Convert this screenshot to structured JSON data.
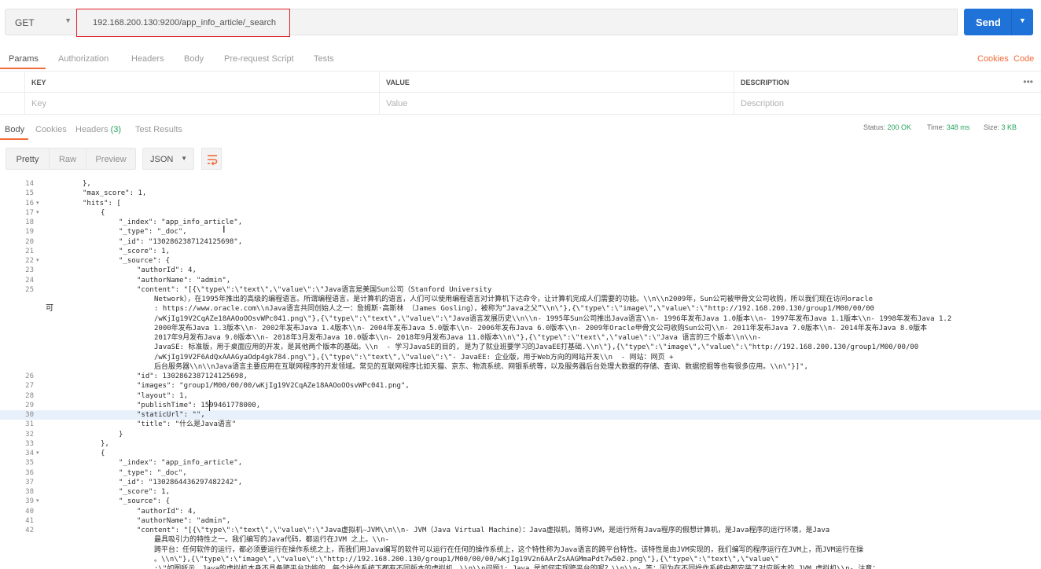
{
  "request": {
    "method": "GET",
    "url": "192.168.200.130:9200/app_info_article/_search",
    "send_label": "Send"
  },
  "request_tabs": [
    "Params",
    "Authorization",
    "Headers",
    "Body",
    "Pre-request Script",
    "Tests"
  ],
  "request_right_links": [
    "Cookies",
    "Code"
  ],
  "params_table": {
    "headers": [
      "KEY",
      "VALUE",
      "DESCRIPTION"
    ],
    "placeholders": [
      "Key",
      "Value",
      "Description"
    ],
    "menu": "•••"
  },
  "response_tabs": {
    "body": "Body",
    "cookies": "Cookies",
    "headers": "Headers",
    "headers_count": "(3)",
    "tests": "Test Results"
  },
  "status": {
    "status_label": "Status:",
    "status_value": "200 OK",
    "time_label": "Time:",
    "time_value": "348 ms",
    "size_label": "Size:",
    "size_value": "3 KB"
  },
  "toolbar": {
    "pretty": "Pretty",
    "raw": "Raw",
    "preview": "Preview",
    "format": "JSON"
  },
  "gutter_stray": "可",
  "code_lines": [
    {
      "n": "14",
      "fold": "",
      "indent": 0,
      "text": "},"
    },
    {
      "n": "15",
      "fold": "",
      "indent": 0,
      "text": "\"max_score\": 1,"
    },
    {
      "n": "16",
      "fold": "▾",
      "indent": 0,
      "text": "\"hits\": ["
    },
    {
      "n": "17",
      "fold": "▾",
      "indent": 1,
      "text": "{"
    },
    {
      "n": "18",
      "fold": "",
      "indent": 2,
      "text": "\"_index\": \"app_info_article\","
    },
    {
      "n": "19",
      "fold": "",
      "indent": 2,
      "text": "\"_type\": \"_doc\","
    },
    {
      "n": "20",
      "fold": "",
      "indent": 2,
      "text": "\"_id\": \"1302862387124125698\","
    },
    {
      "n": "21",
      "fold": "",
      "indent": 2,
      "text": "\"_score\": 1,"
    },
    {
      "n": "22",
      "fold": "▾",
      "indent": 2,
      "text": "\"_source\": {"
    },
    {
      "n": "23",
      "fold": "",
      "indent": 3,
      "text": "\"authorId\": 4,"
    },
    {
      "n": "24",
      "fold": "",
      "indent": 3,
      "text": "\"authorName\": \"admin\","
    },
    {
      "n": "25",
      "fold": "",
      "indent": 3,
      "text": "\"content\": \"[{\\\"type\\\":\\\"text\\\",\\\"value\\\":\\\"Java语言是美国Sun公司（Stanford University"
    },
    {
      "n": "",
      "fold": "",
      "indent": 4,
      "text": "Network），在1995年推出的高级的编程语言。所谓编程语言，是计算机的语言，人们可以使用编程语言对计算机下达命令，让计算机完成人们需要的功能。\\\\n\\\\n2009年，Sun公司被甲骨文公司收购，所以我们现在访问oracle"
    },
    {
      "n": "",
      "fold": "",
      "indent": 4,
      "text": ": https://www.oracle.com\\\\nJava语言共同创始人之一：詹姆斯·高斯林 （James Gosling），被称为“Java之父”\\\\n\\\"},{\\\"type\\\":\\\"image\\\",\\\"value\\\":\\\"http://192.168.200.130/group1/M00/00/00"
    },
    {
      "n": "",
      "fold": "",
      "indent": 4,
      "text": "/wKjIg19V2CqAZe18AAOoOOsvWPc041.png\\\"},{\\\"type\\\":\\\"text\\\",\\\"value\\\":\\\"Java语言发展历史\\\\n\\\\n- 1995年Sun公司推出Java语言\\\\n- 1996年发布Java 1.0版本\\\\n- 1997年发布Java 1.1版本\\\\n- 1998年发布Java 1.2"
    },
    {
      "n": "",
      "fold": "",
      "indent": 4,
      "text": "2000年发布Java 1.3版本\\\\n- 2002年发布Java 1.4版本\\\\n- 2004年发布Java 5.0版本\\\\n- 2006年发布Java 6.0版本\\\\n- 2009年Oracle甲骨文公司收购Sun公司\\\\n- 2011年发布Java 7.0版本\\\\n- 2014年发布Java 8.0版本"
    },
    {
      "n": "",
      "fold": "",
      "indent": 4,
      "text": "2017年9月发布Java 9.0版本\\\\n- 2018年3月发布Java 10.0版本\\\\n- 2018年9月发布Java 11.0版本\\\\n\\\"},{\\\"type\\\":\\\"text\\\",\\\"value\\\":\\\"Java 语言的三个版本\\\\n\\\\n-"
    },
    {
      "n": "",
      "fold": "",
      "indent": 4,
      "text": "JavaSE: 标准版，用于桌面应用的开发，是其他两个版本的基础。\\\\n  - 学习JavaSE的目的, 是为了就业班要学习的JavaEE打基础.\\\\n\\\"},{\\\"type\\\":\\\"image\\\",\\\"value\\\":\\\"http://192.168.200.130/group1/M00/00/00"
    },
    {
      "n": "",
      "fold": "",
      "indent": 4,
      "text": "/wKjIg19V2F6AdQxAAAGyaOdp4gk784.png\\\"},{\\\"type\\\":\\\"text\\\",\\\"value\\\":\\\"- JavaEE: 企业版，用于Web方向的网站开发\\\\n  - 网站：网页 +"
    },
    {
      "n": "",
      "fold": "",
      "indent": 4,
      "text": "后台服务器\\\\n\\\\nJava语言主要应用在互联网程序的开发领域。常见的互联网程序比如天猫、京东、物流系统、网银系统等，以及服务器后台处理大数据的存储、查询、数据挖掘等也有很多应用。\\\\n\\\"}]\","
    },
    {
      "n": "26",
      "fold": "",
      "indent": 3,
      "text": "\"id\": 1302862387124125698,"
    },
    {
      "n": "27",
      "fold": "",
      "indent": 3,
      "text": "\"images\": \"group1/M00/00/00/wKjIg19V2CqAZe18AAOoOOsvWPc041.png\","
    },
    {
      "n": "28",
      "fold": "",
      "indent": 3,
      "text": "\"layout\": 1,"
    },
    {
      "n": "29",
      "fold": "",
      "indent": 3,
      "text": "\"publishTime\": 1599461778000,"
    },
    {
      "n": "30",
      "fold": "",
      "indent": 3,
      "text": "\"staticUrl\": \"\","
    },
    {
      "n": "31",
      "fold": "",
      "indent": 3,
      "text": "\"title\": \"什么是Java语言\""
    },
    {
      "n": "32",
      "fold": "",
      "indent": 2,
      "text": "}"
    },
    {
      "n": "33",
      "fold": "",
      "indent": 1,
      "text": "},"
    },
    {
      "n": "34",
      "fold": "▾",
      "indent": 1,
      "text": "{"
    },
    {
      "n": "35",
      "fold": "",
      "indent": 2,
      "text": "\"_index\": \"app_info_article\","
    },
    {
      "n": "36",
      "fold": "",
      "indent": 2,
      "text": "\"_type\": \"_doc\","
    },
    {
      "n": "37",
      "fold": "",
      "indent": 2,
      "text": "\"_id\": \"1302864436297482242\","
    },
    {
      "n": "38",
      "fold": "",
      "indent": 2,
      "text": "\"_score\": 1,"
    },
    {
      "n": "39",
      "fold": "▾",
      "indent": 2,
      "text": "\"_source\": {"
    },
    {
      "n": "40",
      "fold": "",
      "indent": 3,
      "text": "\"authorId\": 4,"
    },
    {
      "n": "41",
      "fold": "",
      "indent": 3,
      "text": "\"authorName\": \"admin\","
    },
    {
      "n": "42",
      "fold": "",
      "indent": 3,
      "text": "\"content\": \"[{\\\"type\\\":\\\"text\\\",\\\"value\\\":\\\"Java虚拟机—JVM\\\\n\\\\n- JVM（Java Virtual Machine）：Java虚拟机，简称JVM，是运行所有Java程序的假想计算机，是Java程序的运行环境，是Java"
    },
    {
      "n": "",
      "fold": "",
      "indent": 4,
      "text": "最具吸引力的特性之一。我们编写的Java代码，都运行在JVM 之上。\\\\n-"
    },
    {
      "n": "",
      "fold": "",
      "indent": 4,
      "text": "跨平台：任何软件的运行，都必须要运行在操作系统之上，而我们用Java编写的软件可以运行在任何的操作系统上，这个特性称为Java语言的跨平台特性。该特性是由JVM实现的，我们编写的程序运行在JVM上，而JVM运行在操"
    },
    {
      "n": "",
      "fold": "",
      "indent": 4,
      "text": "。\\\\n\\\"},{\\\"type\\\":\\\"image\\\",\\\"value\\\":\\\"http://192.168.200.130/group1/M00/00/00/wKjIg19V2n6AArZsAAGMmaPdt7w502.png\\\"},{\\\"type\\\":\\\"text\\\",\\\"value\\\""
    },
    {
      "n": "",
      "fold": "",
      "indent": 4,
      "text": ":\\\"如图所示，Java的虚拟机本身不具备跨平台功能的，每个操作系统下都有不同版本的虚拟机。\\\\n\\\\n问题1: Java 是如何实现跨平台的呢？\\\\n\\\\n- 答：因为在不同操作系统中都安装了对应版本的 JVM 虚拟机\\\\n- 注意："
    }
  ]
}
